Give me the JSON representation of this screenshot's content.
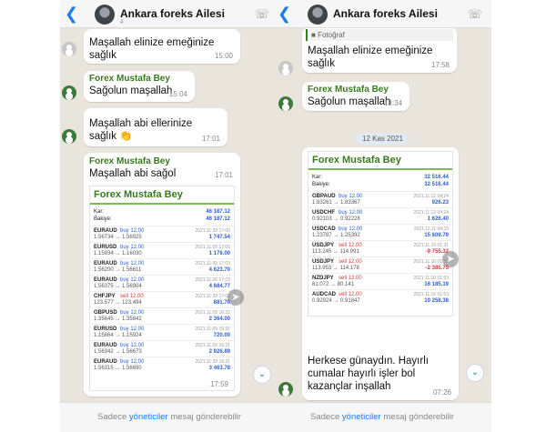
{
  "left": {
    "header": {
      "title": "Ankara foreks Ailesi",
      "sub": "4"
    },
    "messages": [
      {
        "text": "Maşallah elinize emeğinize sağlık",
        "time": "15:00"
      },
      {
        "sender": "Forex Mustafa Bey",
        "text": "Sağolun maşallah",
        "time": "15:04"
      },
      {
        "text": "Maşallah abi ellerinize sağlık 👏",
        "time": "17:01"
      },
      {
        "sender": "Forex Mustafa Bey",
        "text": "Maşallah abi sağol",
        "time": "17:01"
      }
    ],
    "card": {
      "header": "Forex Mustafa Bey",
      "kar_label": "Kar:",
      "kar_value": "46 187.12",
      "bakiye_label": "Bakiye:",
      "bakiye_value": "46 187.12",
      "trades": [
        {
          "sym": "EURAUD",
          "act": "buy 12.00",
          "price": "1.56734 → 1.56925",
          "date": "2021.11.09 17:00",
          "pl": "1 747.54"
        },
        {
          "sym": "EURUSD",
          "act": "buy 12.00",
          "price": "1.15934 → 1.16030",
          "date": "2021.11.09 17:00",
          "pl": "1 176.00"
        },
        {
          "sym": "EURAUD",
          "act": "buy 12.00",
          "price": "1.56200 → 1.56611",
          "date": "2021.11.09 17:03",
          "pl": "4 623.70"
        },
        {
          "sym": "EURAUD",
          "act": "buy 12.00",
          "price": "1.56375 → 1.56904",
          "date": "2021.11.09 17:03",
          "pl": "4 684.77"
        },
        {
          "sym": "CHFJPY",
          "act": "sell 12.00",
          "price": "123.577 → 123.494",
          "date": "2021.11.09 17:03",
          "pl": "881.70"
        },
        {
          "sym": "GBPUSD",
          "act": "buy 12.00",
          "price": "1.35645 → 1.35842",
          "date": "2021.11.09 16:32",
          "pl": "2 364.00"
        },
        {
          "sym": "EURUSD",
          "act": "buy 12.00",
          "price": "1.15864 → 1.15924",
          "date": "2021.11.09 16:31",
          "pl": "720.00"
        },
        {
          "sym": "EURAUD",
          "act": "buy 12.00",
          "price": "1.56342 → 1.56673",
          "date": "2021.11.09 16:31",
          "pl": "2 926.89"
        },
        {
          "sym": "EURAUD",
          "act": "buy 12.00",
          "price": "1.56315 → 1.56690",
          "date": "2021.11.09 16:31",
          "pl": "3 463.78"
        }
      ],
      "time": "17:59"
    },
    "footer": {
      "pre": "Sadece ",
      "link": "yöneticiler",
      "post": " mesaj gönderebilir"
    }
  },
  "right": {
    "header": {
      "title": "Ankara foreks Ailesi"
    },
    "photo_label": "Fotoğraf",
    "messages": [
      {
        "text": "Maşallah elinize emeğinize sağlık",
        "time": "17:58"
      },
      {
        "sender": "Forex Mustafa Bey",
        "text": "Sağolun maşallah",
        "time": "18:34"
      }
    ],
    "date_badge": "12 Kas 2021",
    "card": {
      "header": "Forex Mustafa Bey",
      "kar_label": "Kar:",
      "kar_value": "32 516.44",
      "bakiye_label": "Bakiye:",
      "bakiye_value": "32 516.44",
      "trades": [
        {
          "sym": "GBPAUD",
          "act": "buy 12.00",
          "side": "buy",
          "price": "1.83261 → 1.83367",
          "date": "2021.11.12 04:24",
          "pl": "926.23"
        },
        {
          "sym": "USDCHF",
          "act": "buy 12.00",
          "side": "buy",
          "price": "0.92103 → 0.92228",
          "date": "2021.11.12 04:24",
          "pl": "1 626.40"
        },
        {
          "sym": "USDCAD",
          "act": "buy 12.00",
          "side": "buy",
          "price": "1.23787 → 1.25392",
          "date": "2021.11.11 04:33",
          "pl": "15 609.79"
        },
        {
          "sym": "USDJPY",
          "act": "sell 12.00",
          "side": "sell",
          "price": "113.245 → 114.091",
          "date": "2021.11.10 01:31",
          "pl": "-9 755.32",
          "neg": true
        },
        {
          "sym": "USDJPY",
          "act": "sell 12.00",
          "side": "sell",
          "price": "113.953 → 114.178",
          "date": "2021.11.10 01:31",
          "pl": "-2 385.75",
          "neg": true
        },
        {
          "sym": "NZDJPY",
          "act": "sell 12.00",
          "side": "sell",
          "price": "81.072 → 80.141",
          "date": "2021.11.10 01:53",
          "pl": "16 185.19"
        },
        {
          "sym": "AUDCAD",
          "act": "sell 12.00",
          "side": "sell",
          "price": "0.92924 → 0.91847",
          "date": "2021.11.10 01:53",
          "pl": "10 258.38"
        }
      ]
    },
    "last_message": {
      "text": "Herkese günaydın. Hayırlı cumalar hayırlı işler bol kazançlar inşallah",
      "time": "07:26"
    },
    "footer": {
      "pre": "Sadece ",
      "link": "yöneticiler",
      "post": " mesaj gönderebilir"
    }
  },
  "colors": {
    "accent": "#1a7ee6",
    "sender": "#3a7a1f",
    "chat_bg": "#e9e4dc",
    "buy": "#2e62c4",
    "sell": "#d13a3a"
  }
}
